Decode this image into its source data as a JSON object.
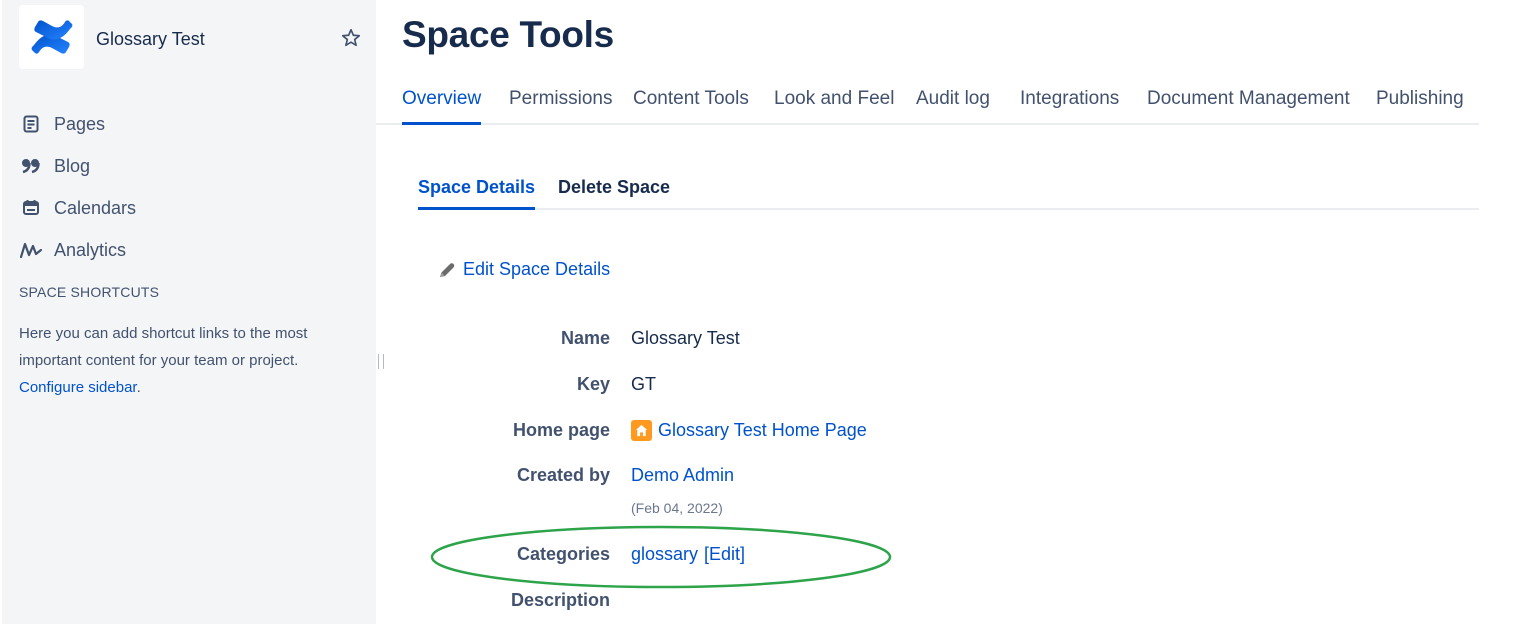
{
  "sidebar": {
    "space_name": "Glossary Test",
    "nav_items": [
      {
        "label": "Pages",
        "icon": "pages-icon"
      },
      {
        "label": "Blog",
        "icon": "blog-quote-icon"
      },
      {
        "label": "Calendars",
        "icon": "calendar-icon"
      },
      {
        "label": "Analytics",
        "icon": "analytics-icon"
      }
    ],
    "shortcuts_title": "SPACE SHORTCUTS",
    "shortcuts_text": "Here you can add shortcut links to the most important content for your team or project.",
    "configure_link": "Configure sidebar",
    "configure_suffix": "."
  },
  "header": {
    "title": "Space Tools",
    "tabs": [
      {
        "label": "Overview",
        "active": true
      },
      {
        "label": "Permissions"
      },
      {
        "label": "Content Tools"
      },
      {
        "label": "Look and Feel"
      },
      {
        "label": "Audit log"
      },
      {
        "label": "Integrations"
      },
      {
        "label": "Document Management"
      },
      {
        "label": "Publishing"
      }
    ]
  },
  "subtabs": [
    {
      "label": "Space Details",
      "active": true
    },
    {
      "label": "Delete Space"
    }
  ],
  "edit_link": "Edit Space Details",
  "details": {
    "name_label": "Name",
    "name_value": "Glossary Test",
    "key_label": "Key",
    "key_value": "GT",
    "home_label": "Home page",
    "home_value": "Glossary Test Home Page",
    "created_label": "Created by",
    "created_value": "Demo Admin",
    "created_date": "(Feb 04, 2022)",
    "categories_label": "Categories",
    "categories_value": "glossary",
    "categories_edit": "[Edit]",
    "description_label": "Description"
  },
  "colors": {
    "brand_blue": "#0052cc",
    "sidebar_bg": "#f4f5f7",
    "annotation_green": "#2da34a",
    "home_icon_orange": "#ff991f"
  }
}
